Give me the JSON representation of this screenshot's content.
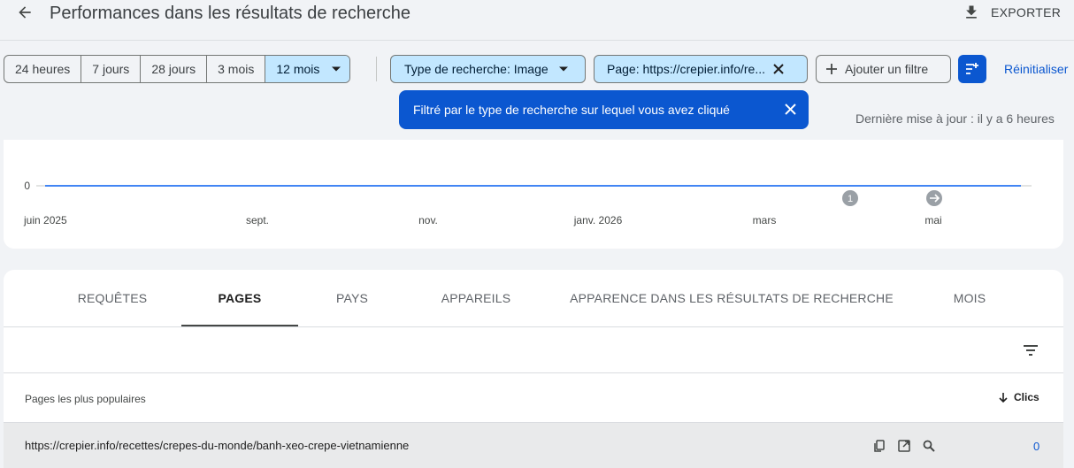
{
  "header": {
    "title": "Performances dans les résultats de recherche",
    "export_label": "EXPORTER"
  },
  "date_ranges": [
    "24 heures",
    "7 jours",
    "28 jours",
    "3 mois",
    "12 mois"
  ],
  "selected_range": "12 mois",
  "filters": {
    "search_type": "Type de recherche: Image",
    "page": "Page: https://crepier.info/re...",
    "add_filter": "Ajouter un filtre",
    "reset": "Réinitialiser"
  },
  "tooltip": {
    "text": "Filtré par le type de recherche sur lequel vous avez cliqué"
  },
  "last_update": "Dernière mise à jour : il y a 6 heures",
  "chart_data": {
    "type": "line",
    "x": [
      "juin 2025",
      "sept.",
      "nov.",
      "janv. 2026",
      "mars",
      "mai"
    ],
    "series": [
      {
        "values": [
          0,
          0,
          0,
          0,
          0,
          0
        ]
      }
    ],
    "ytick": "0",
    "annotations": [
      "1"
    ],
    "colors": {
      "line": "#4285f4"
    }
  },
  "tabs": [
    "REQUÊTES",
    "PAGES",
    "PAYS",
    "APPAREILS",
    "APPARENCE DANS LES RÉSULTATS DE RECHERCHE",
    "MOIS"
  ],
  "active_tab": "PAGES",
  "table": {
    "column_label": "Pages les plus populaires",
    "metric_label": "Clics",
    "rows": [
      {
        "url": "https://crepier.info/recettes/crepes-du-monde/banh-xeo-crepe-vietnamienne",
        "clics": "0"
      }
    ]
  }
}
